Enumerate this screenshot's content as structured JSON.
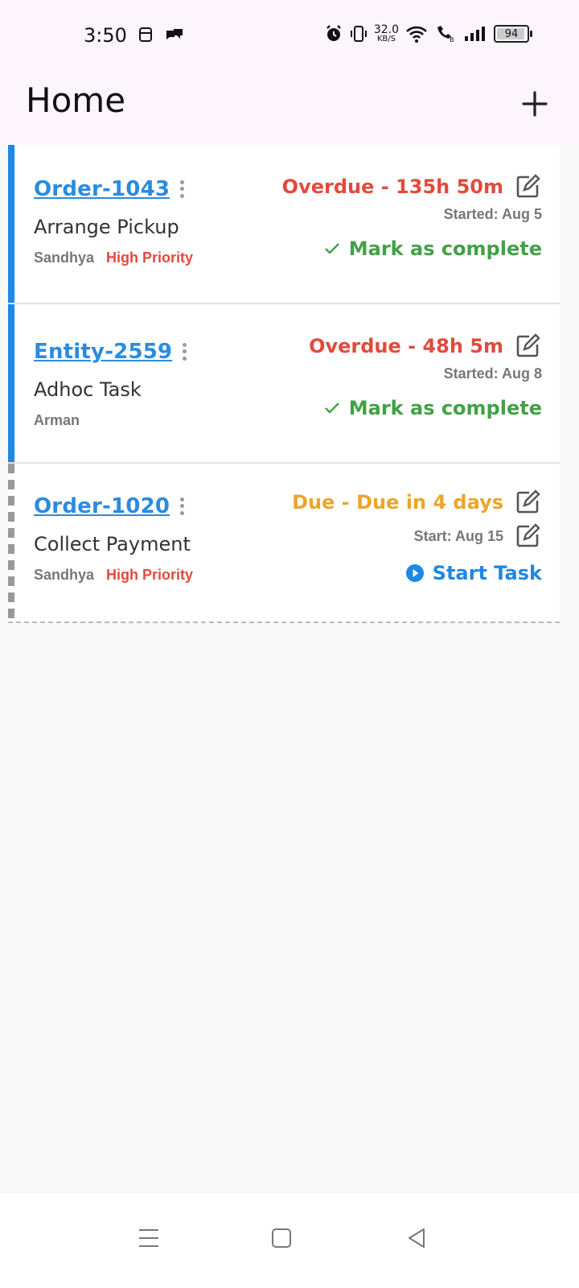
{
  "status_bar": {
    "time": "3:50",
    "net_speed_value": "32.0",
    "net_speed_unit": "KB/S",
    "battery_level": "94"
  },
  "header": {
    "title": "Home",
    "add_icon": "plus-icon"
  },
  "tasks": [
    {
      "id": "Order-1043",
      "name": "Arrange Pickup",
      "assignee": "Sandhya",
      "priority": "High Priority",
      "due": "Overdue - 135h 50m",
      "due_state": "overdue",
      "started": "Started: Aug 5",
      "action": "Mark as complete"
    },
    {
      "id": "Entity-2559",
      "name": "Adhoc Task",
      "assignee": "Arman",
      "priority": "",
      "due": "Overdue - 48h 5m",
      "due_state": "overdue",
      "started": "Started: Aug 8",
      "action": "Mark as complete"
    },
    {
      "id": "Order-1020",
      "name": "Collect Payment",
      "assignee": "Sandhya",
      "priority": "High Priority",
      "due": "Due - Due in 4 days",
      "due_state": "due",
      "started": "Start: Aug 15",
      "action": "Start Task"
    }
  ],
  "colors": {
    "accent_blue": "#1e88e5",
    "overdue_red": "#e24a3c",
    "due_orange": "#eca52a",
    "complete_green": "#43a047",
    "header_bg": "#fdf5fd"
  }
}
